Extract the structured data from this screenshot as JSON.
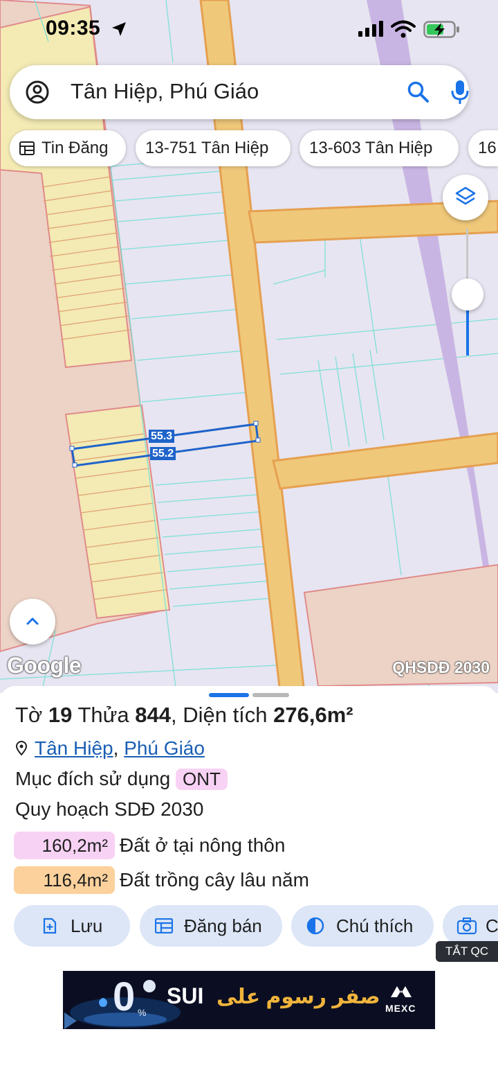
{
  "status": {
    "time": "09:35"
  },
  "search": {
    "text": "Tân Hiệp, Phú Giáo"
  },
  "chips": [
    {
      "label": "Tin Đăng"
    },
    {
      "label": "13-751 Tân Hiệp"
    },
    {
      "label": "13-603 Tân Hiệp"
    },
    {
      "label": "16"
    }
  ],
  "map": {
    "attribution": "Google",
    "plan_label": "QHSDĐ 2030",
    "edge_labels": [
      "55.3",
      "55.2"
    ]
  },
  "parcel": {
    "to_label": "Tờ",
    "to_value": "19",
    "thua_label": "Thửa",
    "thua_value": "844",
    "area_label": "Diện tích",
    "area_value": "276,6m²",
    "location_parts": [
      "Tân Hiệp",
      "Phú Giáo"
    ],
    "location_sep": ",",
    "purpose_label": "Mục đích sử dụng",
    "purpose_code": "ONT",
    "plan_title": "Quy hoạch SDĐ 2030",
    "zones": [
      {
        "area": "160,2m²",
        "desc": "Đất ở tại nông thôn",
        "color": "#f8d2f4"
      },
      {
        "area": "116,4m²",
        "desc": "Đất trồng cây lâu năm",
        "color": "#fcd19c"
      }
    ]
  },
  "actions": [
    {
      "label": "Lưu",
      "icon": "add-file-icon"
    },
    {
      "label": "Đăng bán",
      "icon": "listing-icon"
    },
    {
      "label": "Chú thích",
      "icon": "legend-contrast-icon"
    },
    {
      "label": "C",
      "icon": "camera-icon"
    }
  ],
  "ad": {
    "badge": "TẮT QC",
    "brand": "SUI",
    "arabic": "صفر رسوم على",
    "logo": "MEXC",
    "big": "0",
    "pct": "%"
  },
  "colors": {
    "accent": "#1a73e8",
    "parcel_line": "#1e63c9",
    "road": "#f0c87a"
  }
}
